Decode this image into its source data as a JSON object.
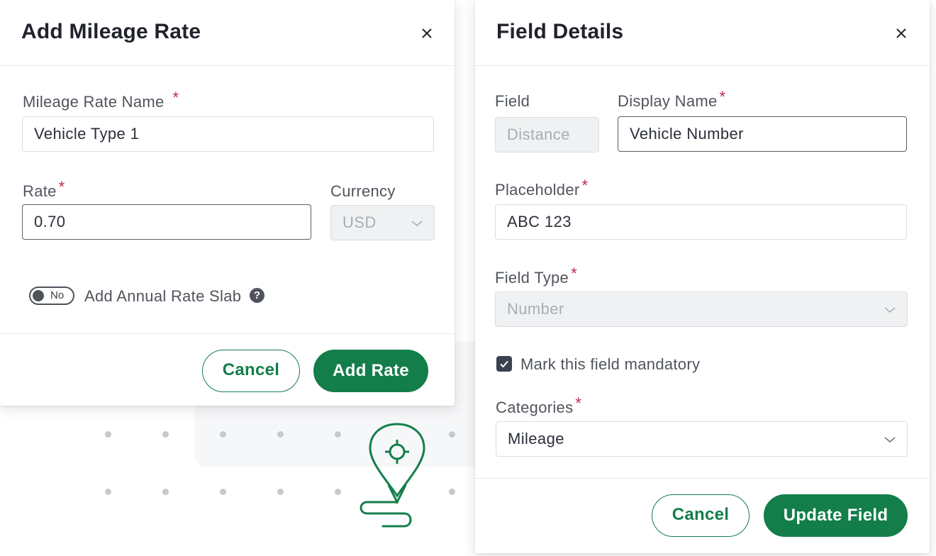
{
  "left_modal": {
    "title": "Add Mileage Rate",
    "name_label": "Mileage Rate Name",
    "name_value": "Vehicle Type 1",
    "rate_label": "Rate",
    "rate_value": "0.70",
    "currency_label": "Currency",
    "currency_value": "USD",
    "toggle_state": "No",
    "toggle_label": "Add Annual Rate Slab",
    "help_glyph": "?",
    "cancel_label": "Cancel",
    "submit_label": "Add Rate"
  },
  "right_modal": {
    "title": "Field Details",
    "field_label": "Field",
    "field_value": "Distance",
    "display_name_label": "Display Name",
    "display_name_value": "Vehicle Number",
    "placeholder_label": "Placeholder",
    "placeholder_value": "ABC 123",
    "field_type_label": "Field Type",
    "field_type_value": "Number",
    "mandatory_label": "Mark this field mandatory",
    "mandatory_checked": true,
    "categories_label": "Categories",
    "categories_value": "Mileage",
    "cancel_label": "Cancel",
    "submit_label": "Update Field"
  },
  "required_marker": "*",
  "colors": {
    "brand_green": "#137e4a",
    "required_red": "#c3294a",
    "text_dark": "#2b2f3a"
  },
  "icons": {
    "close": "close-icon",
    "chevron": "chevron-down-icon",
    "help": "help-icon",
    "check": "check-icon",
    "route": "route-pin-icon"
  }
}
